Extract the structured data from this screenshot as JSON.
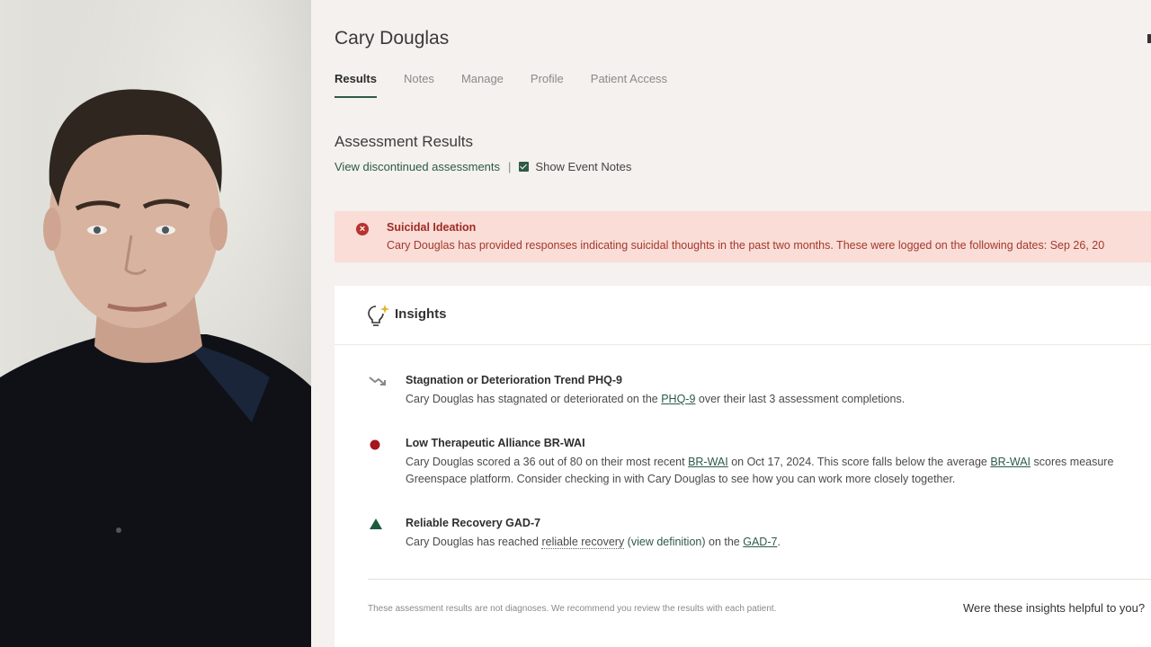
{
  "patient": {
    "name": "Cary Douglas"
  },
  "tabs": [
    {
      "label": "Results",
      "active": true
    },
    {
      "label": "Notes",
      "active": false
    },
    {
      "label": "Manage",
      "active": false
    },
    {
      "label": "Profile",
      "active": false
    },
    {
      "label": "Patient Access",
      "active": false
    }
  ],
  "assessment": {
    "title": "Assessment Results",
    "discontinued_link": "View discontinued assessments",
    "separator": "|",
    "show_event_notes_label": "Show Event Notes",
    "show_event_notes_checked": true
  },
  "alert": {
    "icon": "error-x-icon",
    "title": "Suicidal Ideation",
    "text": "Cary Douglas has provided responses indicating suicidal thoughts in the past two months. These were logged on the following dates: Sep 26, 20"
  },
  "insights": {
    "title": "Insights",
    "icon": "lightbulb-sparkle-icon",
    "items": [
      {
        "icon": "trend-down-icon",
        "title": "Stagnation or Deterioration Trend PHQ-9",
        "text_before": "Cary Douglas has stagnated or deteriorated on the ",
        "link": "PHQ-9",
        "text_after": " over their last 3 assessment completions."
      },
      {
        "icon": "red-dot-icon",
        "title": "Low Therapeutic Alliance BR-WAI",
        "text_a": "Cary Douglas scored a 36 out of 80 on their most recent ",
        "link_a": "BR-WAI",
        "text_b": " on Oct 17, 2024. This score falls below the average ",
        "link_b": "BR-WAI",
        "text_c": " scores measure",
        "text_line2": "Greenspace platform. Consider checking in with Cary Douglas to see how you can work more closely together."
      },
      {
        "icon": "green-triangle-icon",
        "title": "Reliable Recovery GAD-7",
        "text_a": "Cary Douglas has reached ",
        "term": "reliable recovery",
        "definition": " (view definition)",
        "text_b": " on the ",
        "link": "GAD-7",
        "text_c": "."
      }
    ],
    "disclaimer": "These assessment results are not diagnoses. We recommend you review the results with each patient.",
    "feedback_question": "Were these insights helpful to you?"
  },
  "colors": {
    "accent_green": "#2d5a47",
    "alert_bg": "#f9ddd6",
    "alert_text": "#9e2a24",
    "dot_red": "#a8141b",
    "triangle_green": "#1f5a3e"
  }
}
